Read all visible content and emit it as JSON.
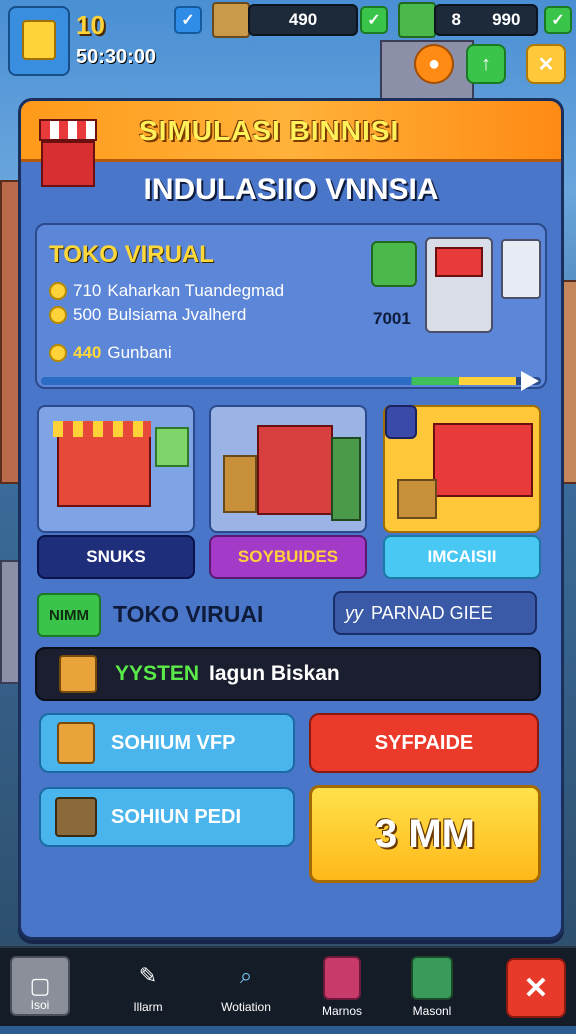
{
  "hud": {
    "level": "10",
    "timer": "50:30:00",
    "resource1": "490",
    "resource2_a": "8",
    "resource2_b": "990"
  },
  "panel": {
    "title": "SIMULASI BINNISI",
    "subtitle": "INDULASIIO VNNSIA"
  },
  "info": {
    "title": "TOKO VIRUAL",
    "line1_value": "710",
    "line1_text": "Kaharkan Tuandegmad",
    "line2_value": "500",
    "line2_text": "Bulsiama Jvalherd",
    "line3_value": "440",
    "line3_text": "Gunbani",
    "price": "7001",
    "progress_percent": 95
  },
  "categories": [
    {
      "label": "SNUKS"
    },
    {
      "label": "SOYBUIDES"
    },
    {
      "label": "IMCAISII"
    }
  ],
  "store_row": {
    "badge": "NIMM",
    "name": "TOKO VIRUAI",
    "right_text": "PARNAD GIEE",
    "right_prefix": "yy"
  },
  "system_row": {
    "highlight": "YYSTEN",
    "text": "Iagun Biskan"
  },
  "buttons": {
    "btn1": "SOHIUM VFP",
    "btn2": "SYFPAIDE",
    "btn3": "SOHIUN PEDI",
    "btn4": "3 MM"
  },
  "nav": [
    {
      "label": "Isoi"
    },
    {
      "label": "Illarm"
    },
    {
      "label": "Wotiation"
    },
    {
      "label": "Marnos"
    },
    {
      "label": "Masonl"
    }
  ]
}
